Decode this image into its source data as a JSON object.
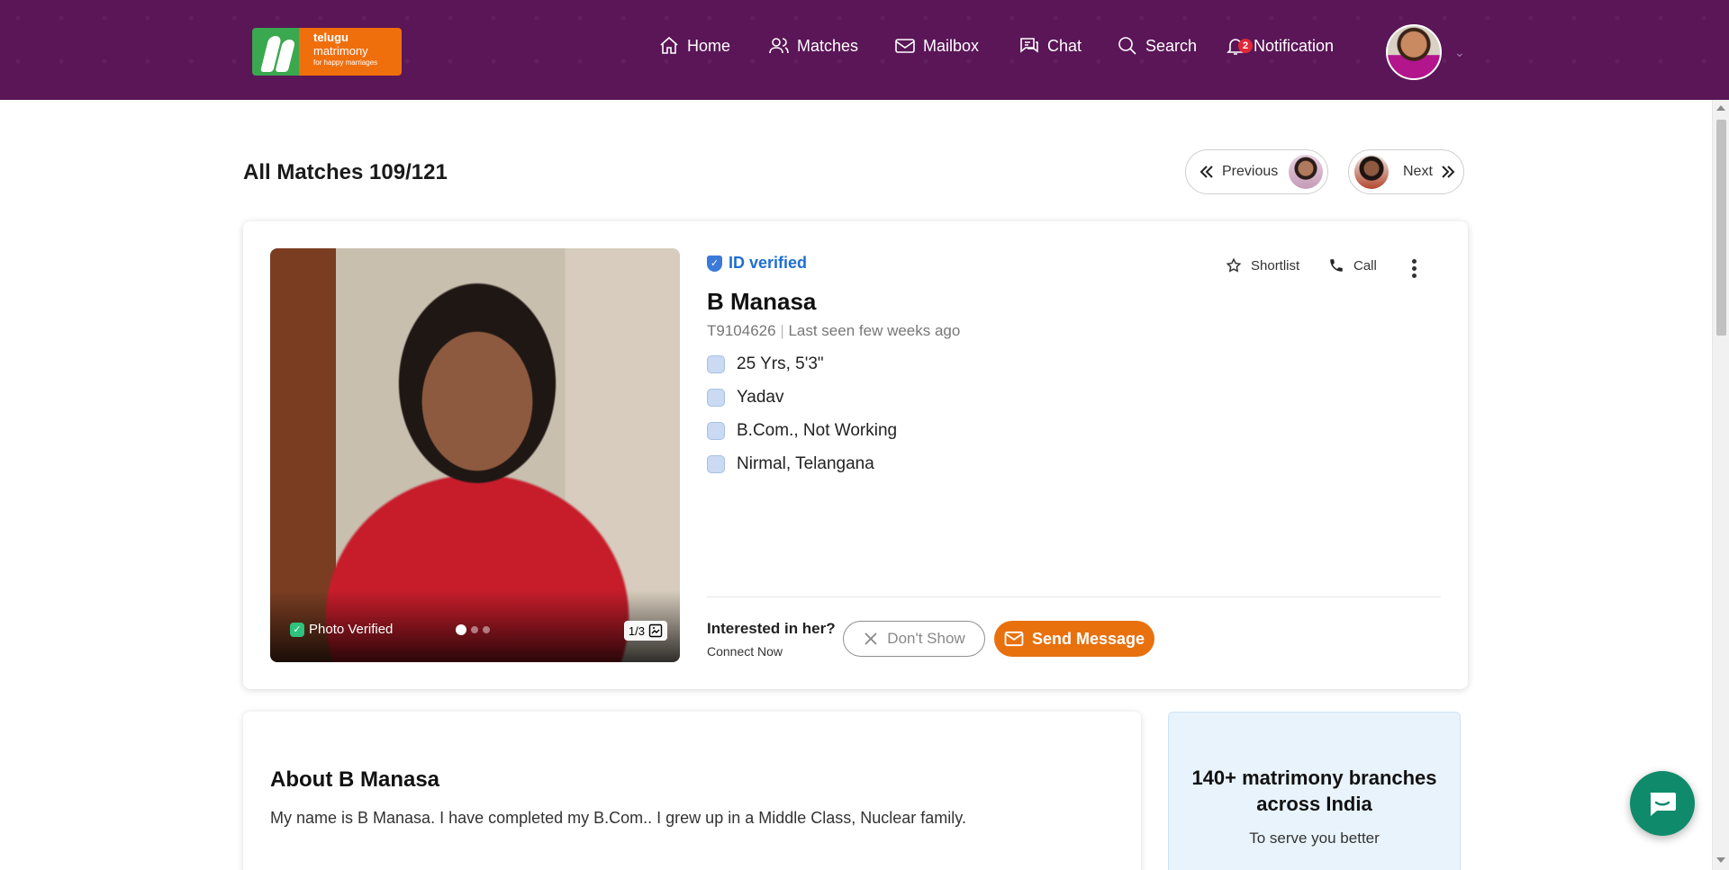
{
  "header": {
    "logo": {
      "line1": "telugu",
      "line2": "matrimony",
      "tagline": "for happy marriages"
    },
    "nav": [
      {
        "label": "Home",
        "icon": "home-icon"
      },
      {
        "label": "Matches",
        "icon": "users-icon"
      },
      {
        "label": "Mailbox",
        "icon": "mail-icon"
      },
      {
        "label": "Chat",
        "icon": "chat-icon"
      },
      {
        "label": "Search",
        "icon": "search-icon"
      },
      {
        "label": "Notification",
        "icon": "bell-icon",
        "badge": "2"
      }
    ],
    "colors": {
      "bar": "#5a1657",
      "badge": "#e0283a"
    }
  },
  "page": {
    "title": "All Matches 109/121",
    "previous_label": "Previous",
    "next_label": "Next"
  },
  "profile": {
    "id_verified": "ID verified",
    "name": "B Manasa",
    "profile_id": "T9104626",
    "last_seen": "Last seen few weeks ago",
    "details": [
      {
        "icon": "age-height-icon",
        "text": "25 Yrs, 5'3\""
      },
      {
        "icon": "community-icon",
        "text": "Yadav"
      },
      {
        "icon": "education-icon",
        "text": "B.Com., Not Working"
      },
      {
        "icon": "location-icon",
        "text": "Nirmal, Telangana"
      }
    ],
    "photo_verified": "Photo Verified",
    "photo_counter": "1/3",
    "actions": {
      "shortlist": "Shortlist",
      "call": "Call"
    },
    "interested_prompt": "Interested in her?",
    "connect_now": "Connect Now",
    "dont_show": "Don't Show",
    "send_message": "Send Message",
    "colors": {
      "accent": "#e8710d",
      "verified": "#1f6fcf"
    }
  },
  "about": {
    "title": "About B Manasa",
    "text": "My name is B Manasa. I have completed my B.Com.. I grew up in a Middle Class, Nuclear family."
  },
  "branches": {
    "title": "140+ matrimony branches across India",
    "subtitle": "To serve you better"
  }
}
